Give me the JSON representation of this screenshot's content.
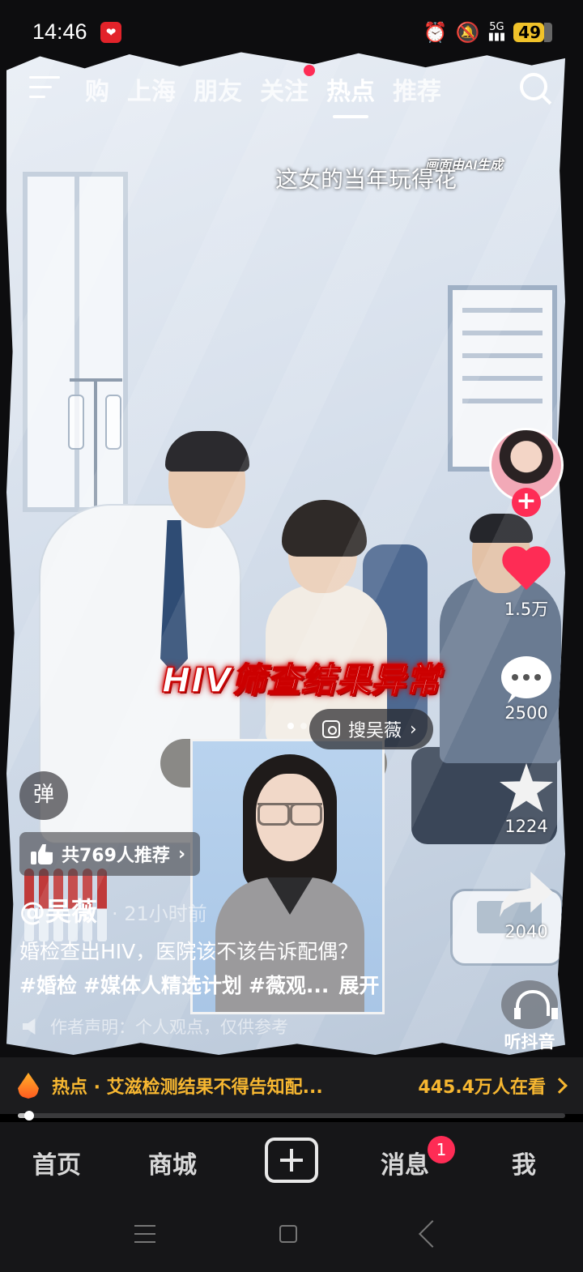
{
  "status_bar": {
    "time": "14:46",
    "network": "5G",
    "battery": "49"
  },
  "top_nav": {
    "tabs": [
      "购",
      "上海",
      "朋友",
      "关注",
      "热点",
      "推荐"
    ],
    "active_tab": "热点"
  },
  "video": {
    "ai_notice": "画面由AI生成",
    "caption_top": "这女的当年玩得花",
    "banner": "HIV筛查结果异常",
    "search_chip": "搜吴薇"
  },
  "rail": {
    "likes": "1.5万",
    "comments": "2500",
    "favorites": "1224",
    "shares": "2040",
    "listen_label": "听抖音"
  },
  "overlay": {
    "danmaku_label": "弹",
    "recommend_label": "共769人推荐",
    "author": "@吴薇",
    "time_ago": "· 21小时前",
    "description": "婚检查出HIV，医院该不该告诉配偶？",
    "tags": [
      "#婚检",
      "#媒体人精选计划",
      "#薇观..."
    ],
    "expand_label": "展开",
    "declaration": "作者声明：个人观点，仅供参考"
  },
  "hot_bar": {
    "title": "热点 · 艾滋检测结果不得告知配...",
    "viewers": "445.4万人在看"
  },
  "progress": {
    "fraction": 0.02
  },
  "bottom_nav": {
    "home": "首页",
    "mall": "商城",
    "messages": "消息",
    "messages_badge": "1",
    "me": "我"
  },
  "colors": {
    "accent": "#fe2c55",
    "hot": "#f7b731",
    "banner_glow": "#d11111"
  }
}
